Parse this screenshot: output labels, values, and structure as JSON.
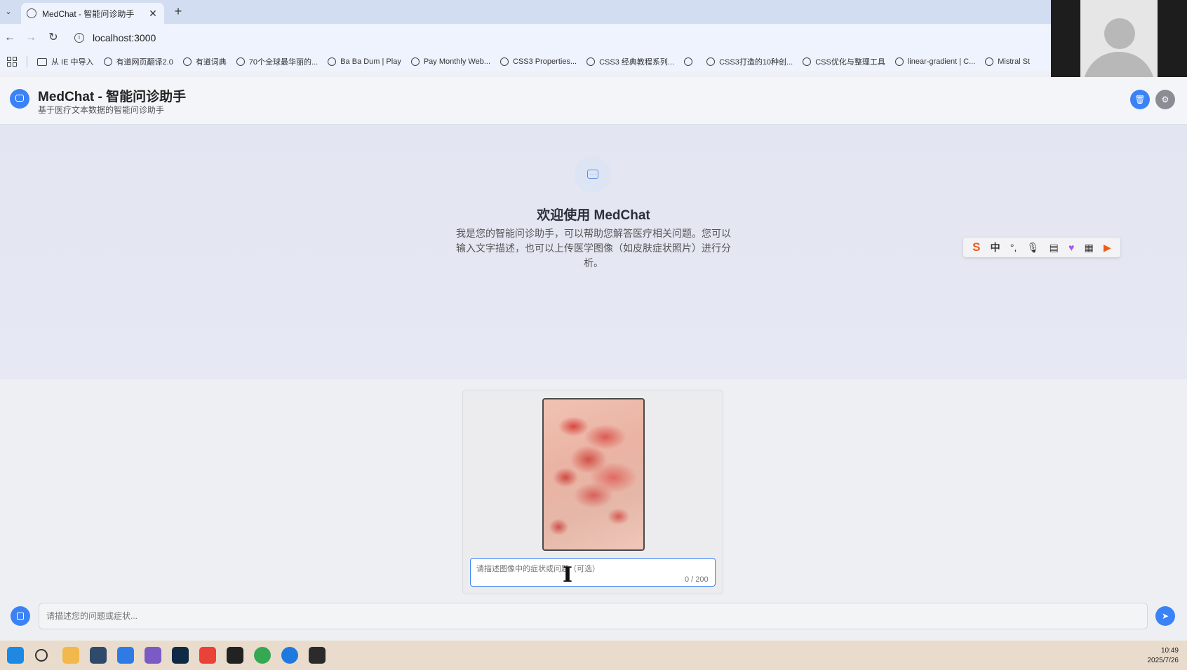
{
  "browser": {
    "tab_title": "MedChat - 智能问诊助手",
    "url": "localhost:3000",
    "bookmarks": [
      {
        "label": "从 IE 中导入",
        "icon": "folder-icon"
      },
      {
        "label": "有道网页翻译2.0",
        "icon": "globe-icon"
      },
      {
        "label": "有道词典",
        "icon": "globe-icon"
      },
      {
        "label": "70个全球最华丽的...",
        "icon": "globe-icon"
      },
      {
        "label": "Ba Ba Dum | Play",
        "icon": "globe-icon"
      },
      {
        "label": "Pay Monthly Web...",
        "icon": "globe-icon"
      },
      {
        "label": "CSS3 Properties...",
        "icon": "globe-icon"
      },
      {
        "label": "CSS3 经典教程系列...",
        "icon": "globe-icon"
      },
      {
        "label": "",
        "icon": "globe-icon"
      },
      {
        "label": "CSS3打造的10种创...",
        "icon": "globe-icon"
      },
      {
        "label": "CSS优化与整理工具",
        "icon": "globe-icon"
      },
      {
        "label": "linear-gradient | C...",
        "icon": "globe-icon"
      },
      {
        "label": "Mistral St",
        "icon": "globe-icon"
      }
    ]
  },
  "app": {
    "title": "MedChat - 智能问诊助手",
    "subtitle": "基于医疗文本数据的智能问诊助手",
    "accent_color": "#3b82f6"
  },
  "welcome": {
    "title": "欢迎使用 MedChat",
    "description": "我是您的智能问诊助手，可以帮助您解答医疗相关问题。您可以输入文字描述，也可以上传医学图像（如皮肤症状照片）进行分析。"
  },
  "ime": {
    "logo": "S",
    "mode": "中",
    "punct": "°,"
  },
  "upload": {
    "image_icon": "skin-photo",
    "desc_placeholder": "请描述图像中的症状或问题（可选）",
    "char_count": "0 / 200"
  },
  "chat": {
    "input_placeholder": "请描述您的问题或症状..."
  },
  "taskbar": {
    "time": "10:49",
    "date": "2025/7/26"
  }
}
